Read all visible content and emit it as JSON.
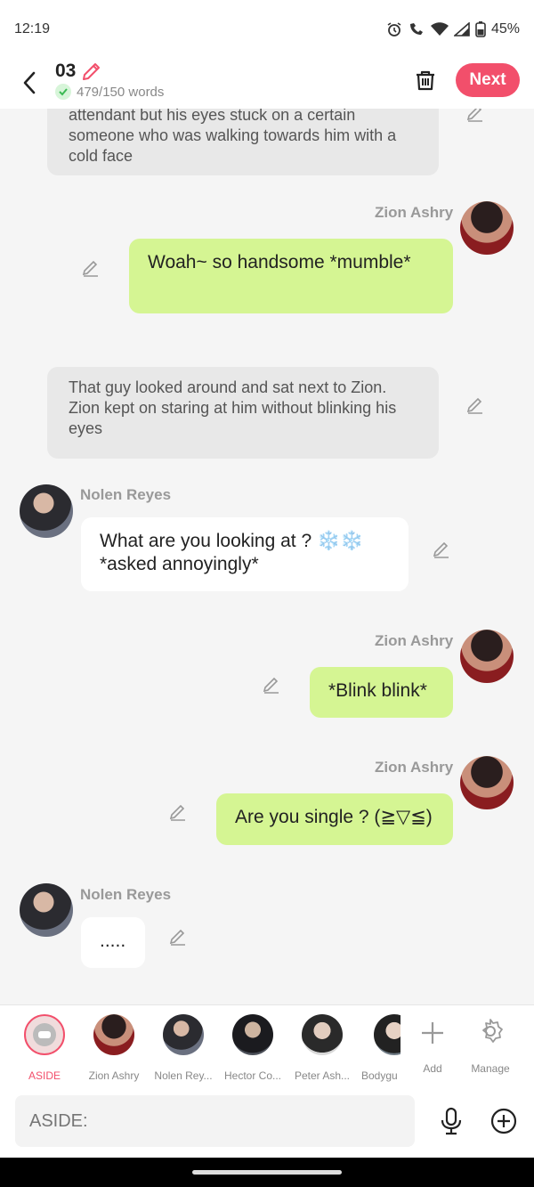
{
  "status": {
    "time": "12:19",
    "battery": "45%"
  },
  "header": {
    "title": "03",
    "word_count": "479/150 words",
    "next_label": "Next"
  },
  "messages": {
    "narration1": "attendant but his eyes stuck on a certain someone who was walking towards him with a cold face",
    "zion1_name": "Zion Ashry",
    "zion1_text": "Woah~ so handsome *mumble*",
    "narration2": "That guy looked around and sat next to Zion. Zion kept on staring at him without blinking his eyes",
    "nolen1_name": "Nolen Reyes",
    "nolen1_text": "What are you looking at ? ❄️❄️ *asked annoyingly*",
    "zion2_name": "Zion Ashry",
    "zion2_text": "*Blink blink*",
    "zion3_name": "Zion Ashry",
    "zion3_text": "Are you single ? (≧▽≦)",
    "nolen2_name": "Nolen Reyes",
    "nolen2_text": "....."
  },
  "characters": [
    {
      "label": "ASIDE"
    },
    {
      "label": "Zion Ashry"
    },
    {
      "label": "Nolen Rey..."
    },
    {
      "label": "Hector Co..."
    },
    {
      "label": "Peter Ash..."
    },
    {
      "label": "Bodygu"
    },
    {
      "label": "Add"
    },
    {
      "label": "Manage"
    }
  ],
  "input": {
    "placeholder": "ASIDE:"
  },
  "colors": {
    "accent": "#f24f6b",
    "user_bubble": "#d5f593",
    "narration_bg": "#e8e8e8"
  },
  "icons": [
    "alarm-icon",
    "wifi-call-icon",
    "wifi-icon",
    "signal-icon",
    "battery-icon",
    "back-arrow-icon",
    "pencil-icon",
    "check-icon",
    "trash-icon",
    "mic-icon",
    "plus-circle-icon",
    "gear-icon",
    "plus-icon"
  ]
}
